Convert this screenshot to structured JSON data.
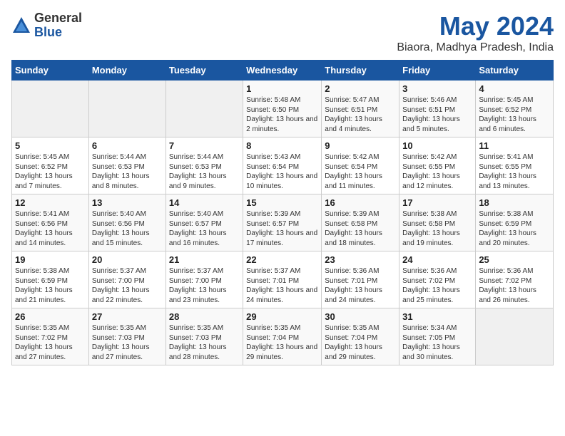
{
  "logo": {
    "general": "General",
    "blue": "Blue"
  },
  "title": "May 2024",
  "subtitle": "Biaora, Madhya Pradesh, India",
  "days_of_week": [
    "Sunday",
    "Monday",
    "Tuesday",
    "Wednesday",
    "Thursday",
    "Friday",
    "Saturday"
  ],
  "weeks": [
    [
      {
        "day": "",
        "sunrise": "",
        "sunset": "",
        "daylight": "",
        "empty": true
      },
      {
        "day": "",
        "sunrise": "",
        "sunset": "",
        "daylight": "",
        "empty": true
      },
      {
        "day": "",
        "sunrise": "",
        "sunset": "",
        "daylight": "",
        "empty": true
      },
      {
        "day": "1",
        "sunrise": "Sunrise: 5:48 AM",
        "sunset": "Sunset: 6:50 PM",
        "daylight": "Daylight: 13 hours and 2 minutes."
      },
      {
        "day": "2",
        "sunrise": "Sunrise: 5:47 AM",
        "sunset": "Sunset: 6:51 PM",
        "daylight": "Daylight: 13 hours and 4 minutes."
      },
      {
        "day": "3",
        "sunrise": "Sunrise: 5:46 AM",
        "sunset": "Sunset: 6:51 PM",
        "daylight": "Daylight: 13 hours and 5 minutes."
      },
      {
        "day": "4",
        "sunrise": "Sunrise: 5:45 AM",
        "sunset": "Sunset: 6:52 PM",
        "daylight": "Daylight: 13 hours and 6 minutes."
      }
    ],
    [
      {
        "day": "5",
        "sunrise": "Sunrise: 5:45 AM",
        "sunset": "Sunset: 6:52 PM",
        "daylight": "Daylight: 13 hours and 7 minutes."
      },
      {
        "day": "6",
        "sunrise": "Sunrise: 5:44 AM",
        "sunset": "Sunset: 6:53 PM",
        "daylight": "Daylight: 13 hours and 8 minutes."
      },
      {
        "day": "7",
        "sunrise": "Sunrise: 5:44 AM",
        "sunset": "Sunset: 6:53 PM",
        "daylight": "Daylight: 13 hours and 9 minutes."
      },
      {
        "day": "8",
        "sunrise": "Sunrise: 5:43 AM",
        "sunset": "Sunset: 6:54 PM",
        "daylight": "Daylight: 13 hours and 10 minutes."
      },
      {
        "day": "9",
        "sunrise": "Sunrise: 5:42 AM",
        "sunset": "Sunset: 6:54 PM",
        "daylight": "Daylight: 13 hours and 11 minutes."
      },
      {
        "day": "10",
        "sunrise": "Sunrise: 5:42 AM",
        "sunset": "Sunset: 6:55 PM",
        "daylight": "Daylight: 13 hours and 12 minutes."
      },
      {
        "day": "11",
        "sunrise": "Sunrise: 5:41 AM",
        "sunset": "Sunset: 6:55 PM",
        "daylight": "Daylight: 13 hours and 13 minutes."
      }
    ],
    [
      {
        "day": "12",
        "sunrise": "Sunrise: 5:41 AM",
        "sunset": "Sunset: 6:56 PM",
        "daylight": "Daylight: 13 hours and 14 minutes."
      },
      {
        "day": "13",
        "sunrise": "Sunrise: 5:40 AM",
        "sunset": "Sunset: 6:56 PM",
        "daylight": "Daylight: 13 hours and 15 minutes."
      },
      {
        "day": "14",
        "sunrise": "Sunrise: 5:40 AM",
        "sunset": "Sunset: 6:57 PM",
        "daylight": "Daylight: 13 hours and 16 minutes."
      },
      {
        "day": "15",
        "sunrise": "Sunrise: 5:39 AM",
        "sunset": "Sunset: 6:57 PM",
        "daylight": "Daylight: 13 hours and 17 minutes."
      },
      {
        "day": "16",
        "sunrise": "Sunrise: 5:39 AM",
        "sunset": "Sunset: 6:58 PM",
        "daylight": "Daylight: 13 hours and 18 minutes."
      },
      {
        "day": "17",
        "sunrise": "Sunrise: 5:38 AM",
        "sunset": "Sunset: 6:58 PM",
        "daylight": "Daylight: 13 hours and 19 minutes."
      },
      {
        "day": "18",
        "sunrise": "Sunrise: 5:38 AM",
        "sunset": "Sunset: 6:59 PM",
        "daylight": "Daylight: 13 hours and 20 minutes."
      }
    ],
    [
      {
        "day": "19",
        "sunrise": "Sunrise: 5:38 AM",
        "sunset": "Sunset: 6:59 PM",
        "daylight": "Daylight: 13 hours and 21 minutes."
      },
      {
        "day": "20",
        "sunrise": "Sunrise: 5:37 AM",
        "sunset": "Sunset: 7:00 PM",
        "daylight": "Daylight: 13 hours and 22 minutes."
      },
      {
        "day": "21",
        "sunrise": "Sunrise: 5:37 AM",
        "sunset": "Sunset: 7:00 PM",
        "daylight": "Daylight: 13 hours and 23 minutes."
      },
      {
        "day": "22",
        "sunrise": "Sunrise: 5:37 AM",
        "sunset": "Sunset: 7:01 PM",
        "daylight": "Daylight: 13 hours and 24 minutes."
      },
      {
        "day": "23",
        "sunrise": "Sunrise: 5:36 AM",
        "sunset": "Sunset: 7:01 PM",
        "daylight": "Daylight: 13 hours and 24 minutes."
      },
      {
        "day": "24",
        "sunrise": "Sunrise: 5:36 AM",
        "sunset": "Sunset: 7:02 PM",
        "daylight": "Daylight: 13 hours and 25 minutes."
      },
      {
        "day": "25",
        "sunrise": "Sunrise: 5:36 AM",
        "sunset": "Sunset: 7:02 PM",
        "daylight": "Daylight: 13 hours and 26 minutes."
      }
    ],
    [
      {
        "day": "26",
        "sunrise": "Sunrise: 5:35 AM",
        "sunset": "Sunset: 7:02 PM",
        "daylight": "Daylight: 13 hours and 27 minutes."
      },
      {
        "day": "27",
        "sunrise": "Sunrise: 5:35 AM",
        "sunset": "Sunset: 7:03 PM",
        "daylight": "Daylight: 13 hours and 27 minutes."
      },
      {
        "day": "28",
        "sunrise": "Sunrise: 5:35 AM",
        "sunset": "Sunset: 7:03 PM",
        "daylight": "Daylight: 13 hours and 28 minutes."
      },
      {
        "day": "29",
        "sunrise": "Sunrise: 5:35 AM",
        "sunset": "Sunset: 7:04 PM",
        "daylight": "Daylight: 13 hours and 29 minutes."
      },
      {
        "day": "30",
        "sunrise": "Sunrise: 5:35 AM",
        "sunset": "Sunset: 7:04 PM",
        "daylight": "Daylight: 13 hours and 29 minutes."
      },
      {
        "day": "31",
        "sunrise": "Sunrise: 5:34 AM",
        "sunset": "Sunset: 7:05 PM",
        "daylight": "Daylight: 13 hours and 30 minutes."
      },
      {
        "day": "",
        "sunrise": "",
        "sunset": "",
        "daylight": "",
        "empty": true
      }
    ]
  ]
}
